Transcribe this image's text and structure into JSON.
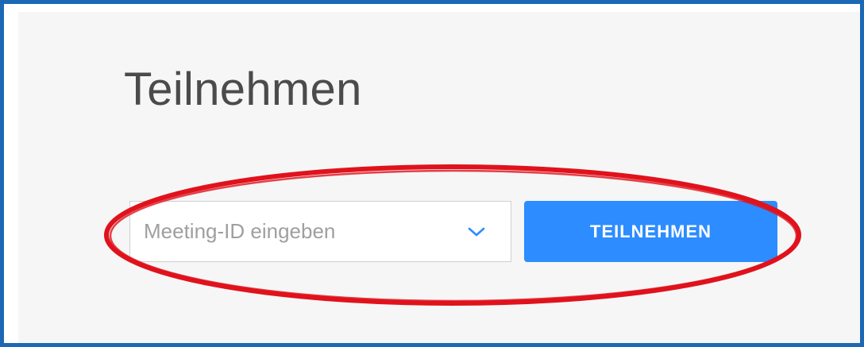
{
  "page": {
    "title": "Teilnehmen"
  },
  "join_form": {
    "meeting_id_placeholder": "Meeting-ID eingeben",
    "join_button_label": "TEILNEHMEN"
  },
  "icons": {
    "dropdown": "chevron-down-icon"
  },
  "colors": {
    "frame_border": "#1c68b4",
    "panel_background": "#f6f6f6",
    "button_background": "#2d8cff",
    "chevron": "#2d8cff",
    "annotation_ellipse": "#e0121c"
  }
}
